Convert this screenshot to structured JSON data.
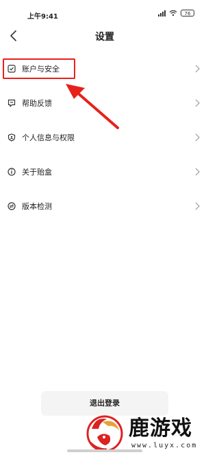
{
  "status_bar": {
    "time": "上午9:41",
    "battery": "76"
  },
  "header": {
    "title": "设置"
  },
  "menu": {
    "items": [
      {
        "label": "账户与安全",
        "icon": "shield-check-icon",
        "highlighted": true
      },
      {
        "label": "帮助反馈",
        "icon": "feedback-icon"
      },
      {
        "label": "个人信息与权限",
        "icon": "privacy-icon"
      },
      {
        "label": "关于贻盒",
        "icon": "info-icon"
      },
      {
        "label": "版本检测",
        "icon": "version-check-icon"
      }
    ]
  },
  "logout": {
    "label": "退出登录"
  },
  "watermark": {
    "text": "鹿游戏",
    "url": "www.luyx.com"
  },
  "colors": {
    "annotation": "#e8201a",
    "text": "#222222",
    "chevron": "#9a9a9a",
    "button_bg": "#f4f4f4"
  }
}
